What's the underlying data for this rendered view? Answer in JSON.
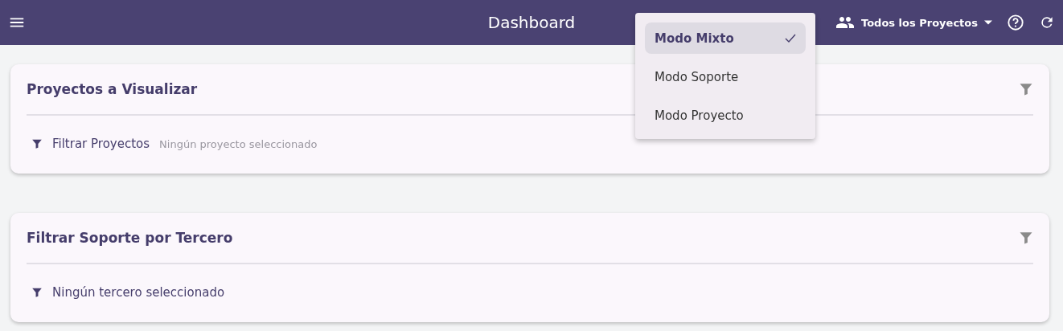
{
  "header": {
    "title": "Dashboard",
    "project_selector": "Todos los Proyectos"
  },
  "mode_menu": [
    {
      "label": "Modo Mixto",
      "selected": true
    },
    {
      "label": "Modo Soporte",
      "selected": false
    },
    {
      "label": "Modo Proyecto",
      "selected": false
    }
  ],
  "cards": [
    {
      "title": "Proyectos a Visualizar",
      "filter_label": "Filtrar Proyectos",
      "status": "Ningún proyecto seleccionado"
    },
    {
      "title": "Filtrar Soporte por Tercero",
      "status": "Ningún tercero seleccionado"
    }
  ]
}
